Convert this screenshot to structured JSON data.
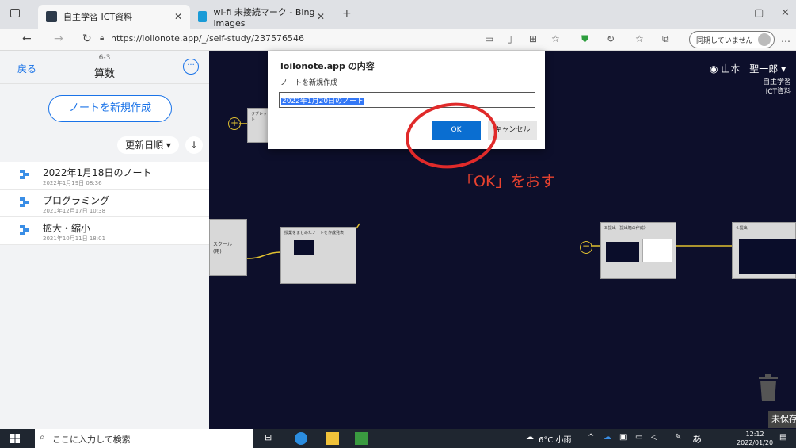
{
  "browser": {
    "tabs": [
      {
        "title": "自主学習 ICT資料",
        "active": true
      },
      {
        "title": "wi-fi 未接続マーク - Bing images",
        "active": false
      }
    ],
    "new_tab_glyph": "+",
    "url": "https://loilonote.app/_/self-study/237576546",
    "sync_label": "同期していません",
    "more_glyph": "…"
  },
  "sidebar": {
    "back_label": "戻る",
    "grade": "6-3",
    "subject": "算数",
    "more_glyph": "···",
    "new_note_label": "ノートを新規作成",
    "sort_label": "更新日順 ▾",
    "sort_dir_glyph": "↓",
    "notes": [
      {
        "title": "2022年1月18日のノート",
        "date": "2022年1月19日 08:36"
      },
      {
        "title": "プログラミング",
        "date": "2021年12月17日 10:38"
      },
      {
        "title": "拡大・縮小",
        "date": "2021年10月11日 18:01"
      }
    ]
  },
  "canvas": {
    "user_name": "山本　聖一郎 ▾",
    "app_title_line1": "自主学習",
    "app_title_line2": "ICT資料",
    "cards": [
      {
        "label": "タブレット"
      },
      {
        "label": "スクール\n(用)"
      },
      {
        "label": "授業をまとめたノートを作成発表"
      },
      {
        "label": "3.提出（提出箱の作成）"
      },
      {
        "label": "4.提出"
      }
    ],
    "hint": "「OK」をおす",
    "unsaved_label": "未保存"
  },
  "dialog": {
    "title": "loilonote.app の内容",
    "message": "ノートを新規作成",
    "input_value": "2022年1月20日のノート",
    "ok_label": "OK",
    "cancel_label": "キャンセル"
  },
  "taskbar": {
    "search_placeholder": "ここに入力して検索",
    "weather": "6°C 小雨",
    "ime": "あ",
    "time": "12:12",
    "date": "2022/01/20"
  },
  "colors": {
    "accent": "#1a73e8",
    "canvas_bg": "#0d0f2b",
    "hint_red": "#e8422f",
    "connector": "#e0c030"
  }
}
